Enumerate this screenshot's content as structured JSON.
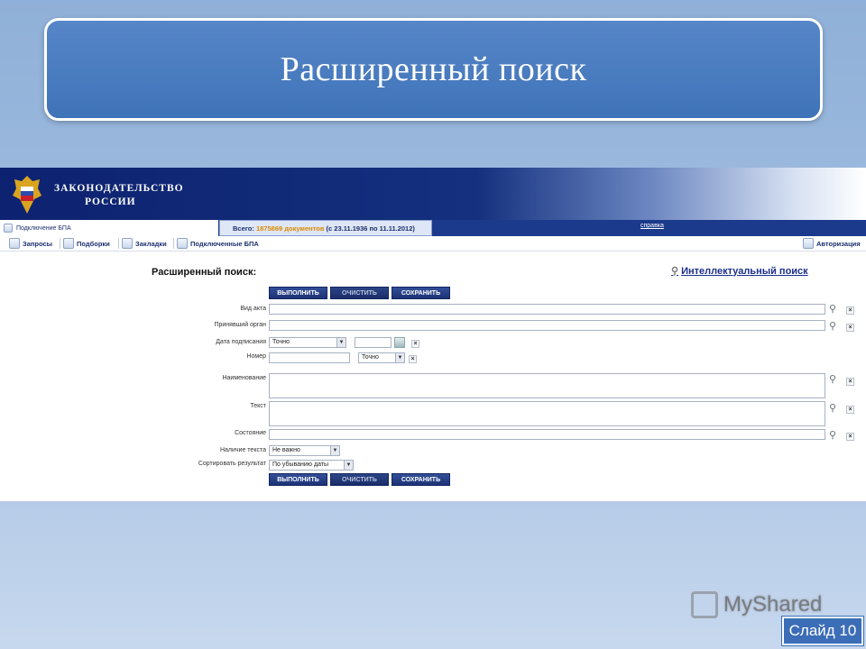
{
  "slide": {
    "title": "Расширенный поиск",
    "slide_label": "Слайд 10",
    "watermark": "MyShared"
  },
  "app": {
    "brand_line1": "ЗАКОНОДАТЕЛЬСТВО",
    "brand_line2": "РОССИИ",
    "connect_label": "Подключение БПА",
    "total_prefix": "Всего:",
    "total_count": "1875869 документов",
    "total_range": "(с 23.11.1936 по 11.11.2012)",
    "help_link": "справка",
    "toolbar": {
      "requests": "Запросы",
      "collections": "Подборки",
      "bookmarks": "Закладки",
      "connected": "Подключенные БПА",
      "auth": "Авторизация"
    }
  },
  "form": {
    "title": "Расширенный поиск:",
    "intel_link": "Интеллектуальный поиск",
    "buttons": {
      "run": "ВЫПОЛНИТЬ",
      "clear": "ОЧИСТИТЬ",
      "save": "СОХРАНИТЬ"
    },
    "labels": {
      "act_type": "Вид акта",
      "authority": "Принявший орган",
      "sign_date": "Дата подписания",
      "number": "Номер",
      "name": "Наименование",
      "text": "Текст",
      "state": "Состояние",
      "has_text": "Наличие текста",
      "sort": "Сортировать результат"
    },
    "values": {
      "date_mode": "Точно",
      "number_mode": "Точно",
      "has_text": "Не важно",
      "sort": "По убыванию даты"
    }
  }
}
